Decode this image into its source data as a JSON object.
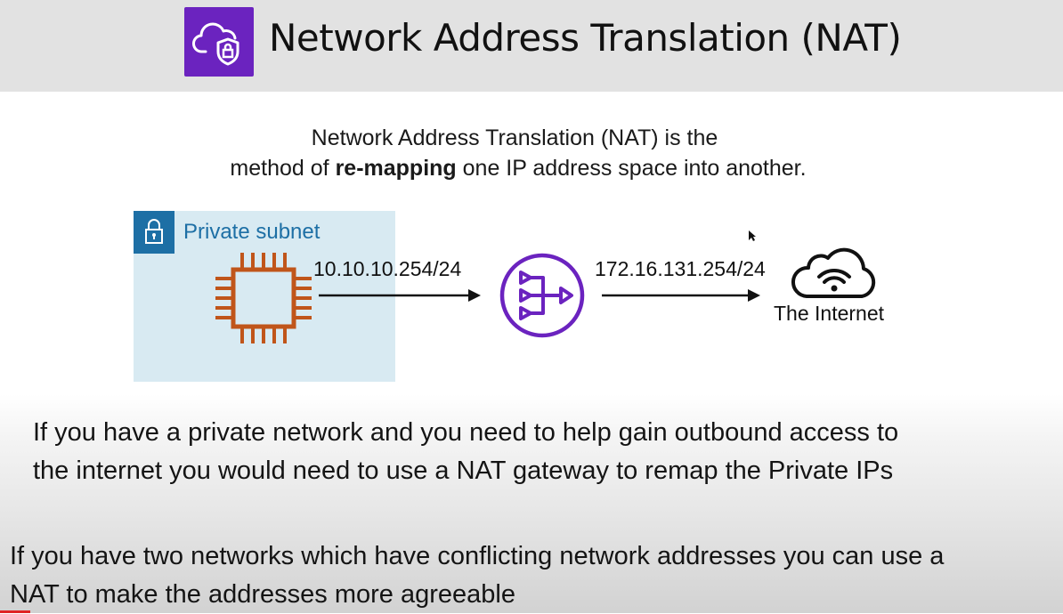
{
  "header": {
    "title": "Network Address Translation (NAT)",
    "logo_icon": "cloud-shield-icon",
    "logo_bg": "#6b23bf"
  },
  "intro": {
    "line1": "Network Address Translation (NAT) is the",
    "line2_prefix": "method of ",
    "line2_bold": "re-mapping",
    "line2_suffix": " one IP address space into another."
  },
  "diagram": {
    "subnet_label": "Private subnet",
    "private_ip": "10.10.10.254/24",
    "public_ip": "172.16.131.254/24",
    "internet_label": "The Internet",
    "icons": [
      "lock-icon",
      "ec2-instance-icon",
      "nat-gateway-icon",
      "internet-cloud-icon"
    ],
    "colors": {
      "subnet_bg": "#d8eaf2",
      "subnet_accent": "#1d6fa5",
      "instance": "#c0551a",
      "nat": "#6b23bf"
    }
  },
  "bullets": [
    {
      "line1": "If you have a private network and you need to help gain outbound access to",
      "line2": "the internet you would need to use a NAT gateway to remap the Private IPs"
    },
    {
      "line1": "If you have two networks which have conflicting network addresses you can use a",
      "line2": "NAT to make the addresses more agreeable"
    }
  ]
}
